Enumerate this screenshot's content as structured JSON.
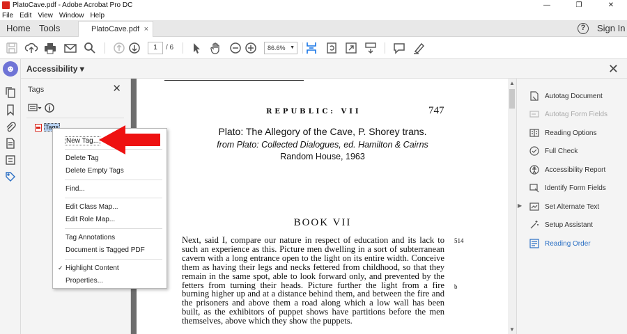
{
  "window": {
    "title": "PlatoCave.pdf - Adobe Acrobat Pro DC",
    "controls": [
      "—",
      "❐",
      "✕"
    ]
  },
  "menubar": [
    "File",
    "Edit",
    "View",
    "Window",
    "Help"
  ],
  "tabs": {
    "home": "Home",
    "tools": "Tools",
    "document": "PlatoCave.pdf",
    "document_close": "×",
    "sign_in": "Sign In",
    "help": "?"
  },
  "toolbar": {
    "page_current": "1",
    "page_total": "/ 6",
    "zoom": "86.6%",
    "zoom_caret": "▼"
  },
  "accessibility_header": {
    "label": "Accessibility ▾",
    "close": "✕"
  },
  "tags_panel": {
    "title": "Tags",
    "close": "✕",
    "root_tag": "Tags"
  },
  "context_menu": {
    "items": [
      "New Tag...",
      "Delete Tag",
      "Delete Empty Tags",
      "Find...",
      "Edit Class Map...",
      "Edit Role Map...",
      "Tag Annotations",
      "Document is Tagged PDF",
      "Highlight Content",
      "Properties..."
    ],
    "checkmark": "✓"
  },
  "document": {
    "running_head": "REPUBLIC: VII",
    "page_number": "747",
    "title_line1": "Plato: The Allegory of the Cave, P. Shorey trans.",
    "title_line2": "from Plato: Collected Dialogues, ed. Hamilton & Cairns",
    "title_line3": "Random House, 1963",
    "book_heading": "BOOK VII",
    "body": "Next, said I, compare our nature in respect of education and its lack to such an experience as this. Picture men dwelling in a sort of subterranean cavern with a long entrance open to the light on its entire width. Conceive them as having their legs and necks fettered from childhood, so that they remain in the same spot, able to look forward only, and prevented by the fetters from turning their heads. Picture further the light from a fire burning higher up and at a distance behind them, and between the fire and the prisoners and above them a road along which a low wall has been built, as the exhibitors of puppet shows have partitions before the men themselves, above which they show the puppets.",
    "margin_514": "514",
    "margin_b": "b"
  },
  "right_panel": {
    "items": [
      "Autotag Document",
      "Autotag Form Fields",
      "Reading Options",
      "Full Check",
      "Accessibility Report",
      "Identify Form Fields",
      "Set Alternate Text",
      "Setup Assistant",
      "Reading Order"
    ]
  },
  "colors": {
    "accent": "#1473e6",
    "acrobat_red": "#d9261c",
    "arrow_red": "#ee1111",
    "accessibility_purple": "#6f74d6"
  }
}
